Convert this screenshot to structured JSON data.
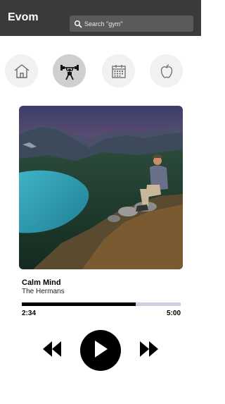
{
  "header": {
    "brand": "Evom",
    "search_placeholder": "Search \"gym\""
  },
  "nav": {
    "items": [
      {
        "icon": "home-icon",
        "active": false
      },
      {
        "icon": "dumbbell-person-icon",
        "active": true
      },
      {
        "icon": "calendar-icon",
        "active": false
      },
      {
        "icon": "apple-icon",
        "active": false
      }
    ]
  },
  "player": {
    "title": "Calm Mind",
    "artist": "The Hermans",
    "elapsed": "2:34",
    "total": "5:00",
    "progress": 0.715
  },
  "colors": {
    "header_bg": "#3a3a3a",
    "progress_fill": "#000000",
    "progress_track": "#cfcdde",
    "nav_bg": "#f1f1f1",
    "nav_active_bg": "#cfcfcf"
  }
}
